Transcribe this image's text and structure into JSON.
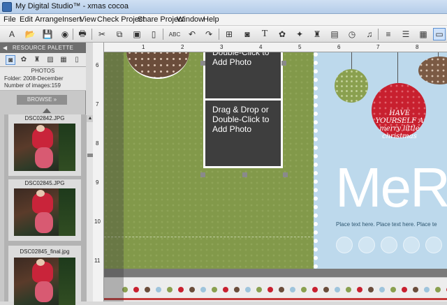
{
  "window": {
    "title": "My Digital Studio™ - xmas cocoa"
  },
  "menu": [
    "File",
    "Edit",
    "Arrange",
    "Insert",
    "View",
    "Check Project",
    "Share Project",
    "Window",
    "Help"
  ],
  "toolbar": {
    "items": [
      {
        "name": "text-style-icon",
        "glyph": "A"
      },
      {
        "name": "open-folder-icon",
        "glyph": "📂"
      },
      {
        "name": "save-icon",
        "glyph": "💾"
      },
      {
        "name": "record-icon",
        "glyph": "◉"
      },
      {
        "name": "print-icon",
        "glyph": "🖶"
      },
      {
        "name": "cut-icon",
        "glyph": "✂"
      },
      {
        "name": "copy-icon",
        "glyph": "⧉"
      },
      {
        "name": "paste-icon",
        "glyph": "▣"
      },
      {
        "name": "page-icon",
        "glyph": "▯"
      },
      {
        "name": "spellcheck-icon",
        "glyph": "ABC"
      },
      {
        "name": "undo-icon",
        "glyph": "↶"
      },
      {
        "name": "redo-icon",
        "glyph": "↷"
      },
      {
        "name": "add-page-icon",
        "glyph": "⊞"
      },
      {
        "name": "photo-box-icon",
        "glyph": "◙"
      },
      {
        "name": "text-box-icon",
        "glyph": "T"
      },
      {
        "name": "embellishment-icon",
        "glyph": "✿"
      },
      {
        "name": "stamp-icon",
        "glyph": "✦"
      },
      {
        "name": "stamp-tool-icon",
        "glyph": "♜"
      },
      {
        "name": "film-icon",
        "glyph": "▤"
      },
      {
        "name": "clock-icon",
        "glyph": "◷"
      },
      {
        "name": "music-icon",
        "glyph": "♫"
      },
      {
        "name": "layers-icon",
        "glyph": "≡"
      },
      {
        "name": "align-icon",
        "glyph": "☰"
      },
      {
        "name": "grid-icon",
        "glyph": "▦"
      },
      {
        "name": "preview-icon",
        "glyph": "▭"
      }
    ]
  },
  "palette": {
    "header": "RESOURCE PALETTE",
    "info": {
      "section": "PHOTOS",
      "folder": "Folder: 2008-December",
      "count": "Number of images:159"
    },
    "browse_label": "BROWSE  »",
    "thumbnails": [
      {
        "file": "DSC02842.JPG"
      },
      {
        "file": "DSC02845.JPG"
      },
      {
        "file": "DSC02845_final.jpg"
      }
    ]
  },
  "rulers": {
    "top": [
      "1",
      "2",
      "3",
      "4",
      "5",
      "6",
      "7",
      "8"
    ],
    "left": [
      "6",
      "7",
      "8",
      "9",
      "10",
      "11"
    ]
  },
  "canvas": {
    "photo_placeholder": "Drag & Drop or Double-Click to Add Photo",
    "title_text": "MeR",
    "place_text": "Place text here. Place text here. Place te",
    "ornament_text": "HAVE YOURSELF A merry little christmas",
    "colors": {
      "green_paper": "#82994a",
      "blue_paper": "#bdd9ec",
      "red_ornament": "#c8202f",
      "olive_ornament": "#8aa04f",
      "brown": "#6b4d3b"
    }
  }
}
